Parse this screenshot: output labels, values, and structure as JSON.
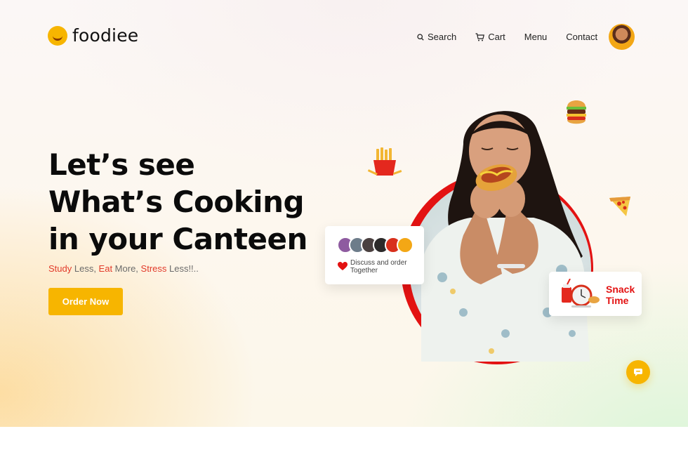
{
  "brand": {
    "name": "foodiee",
    "logo_icon": "smile-logo-icon",
    "accent": "#f7b500"
  },
  "nav": {
    "search": "Search",
    "cart": "Cart",
    "menu": "Menu",
    "contact": "Contact"
  },
  "hero": {
    "headline_line1": "Let’s see",
    "headline_line2": "What’s Cooking",
    "headline_line3": "in your Canteen",
    "tagline": {
      "w1": "Study",
      "t1": " Less, ",
      "w2": "Eat",
      "t2": " More, ",
      "w3": "Stress",
      "t3": " Less!!.."
    },
    "cta": "Order Now"
  },
  "discuss_card": {
    "text": "Discuss and order Together",
    "icon": "heart-icon"
  },
  "snack_card": {
    "line1": "Snack",
    "line2": "Time"
  },
  "colors": {
    "red": "#e31212",
    "yellow": "#f7b500"
  }
}
